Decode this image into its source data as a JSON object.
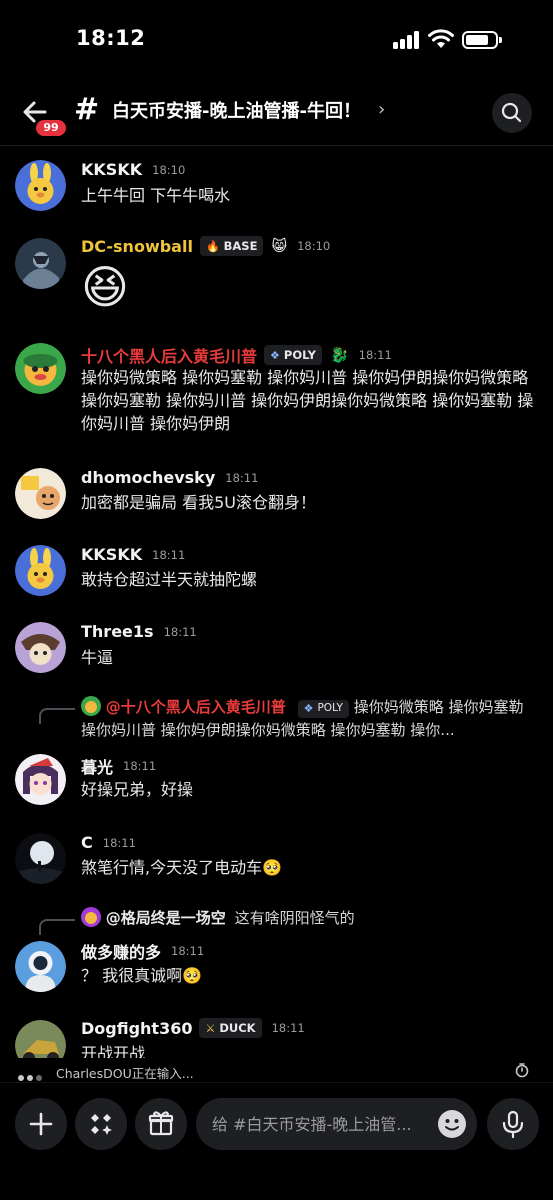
{
  "status_bar": {
    "time": "18:12"
  },
  "header": {
    "unread_badge": "99",
    "channel_title": "白天币安播-晚上油管播-牛回！"
  },
  "messages": [
    {
      "username": "KKSKK",
      "time": "18:10",
      "text": "上午牛回 下午牛喝水"
    },
    {
      "username": "DC-snowball",
      "tag": "BASE",
      "time": "18:10",
      "text": "😆"
    },
    {
      "username": "十八个黑人后入黄毛川普",
      "tag": "POLY",
      "time": "18:11",
      "text": "操你妈微策略 操你妈塞勒 操你妈川普 操你妈伊朗操你妈微策略 操你妈塞勒 操你妈川普 操你妈伊朗操你妈微策略 操你妈塞勒 操你妈川普 操你妈伊朗"
    },
    {
      "username": "dhomochevsky",
      "time": "18:11",
      "text": "加密都是骗局 看我5U滚仓翻身！"
    },
    {
      "username": "KKSKK",
      "time": "18:11",
      "text": "敢持仓超过半天就抽陀螺"
    },
    {
      "username": "Three1s",
      "time": "18:11",
      "text": "牛逼"
    },
    {
      "reply_to": {
        "username": "@十八个黑人后入黄毛川普",
        "tag": "POLY",
        "text": "操你妈微策略 操你妈塞勒 操你妈川普 操你妈伊朗操你妈微策略 操你妈塞勒 操你..."
      },
      "username": "暮光",
      "time": "18:11",
      "text": "好操兄弟，好操"
    },
    {
      "username": "C",
      "time": "18:11",
      "text": "煞笔行情,今天没了电动车🥺"
    },
    {
      "reply_to": {
        "username": "@格局终是一场空",
        "text": "这有啥阴阳怪气的"
      },
      "username": "做多赚的多",
      "time": "18:11",
      "text": "？ 我很真诚啊🥺"
    },
    {
      "username": "Dogfight360",
      "tag": "DUCK",
      "time": "18:11",
      "text": "开战开战"
    }
  ],
  "typing": {
    "text": "CharlesDOU正在输入..."
  },
  "composer": {
    "placeholder": "给 #白天币安播-晚上油管..."
  },
  "icons": [
    "back-arrow-icon",
    "hash-icon",
    "chevron-right-icon",
    "search-icon",
    "plus-icon",
    "apps-icon",
    "gift-icon",
    "emoji-icon",
    "microphone-icon",
    "timer-icon"
  ],
  "colors": {
    "background": "#000000",
    "surface": "#1e1f22",
    "badge": "#e5323e",
    "name_yellow": "#f0c43a",
    "name_red": "#ea3b3b"
  }
}
